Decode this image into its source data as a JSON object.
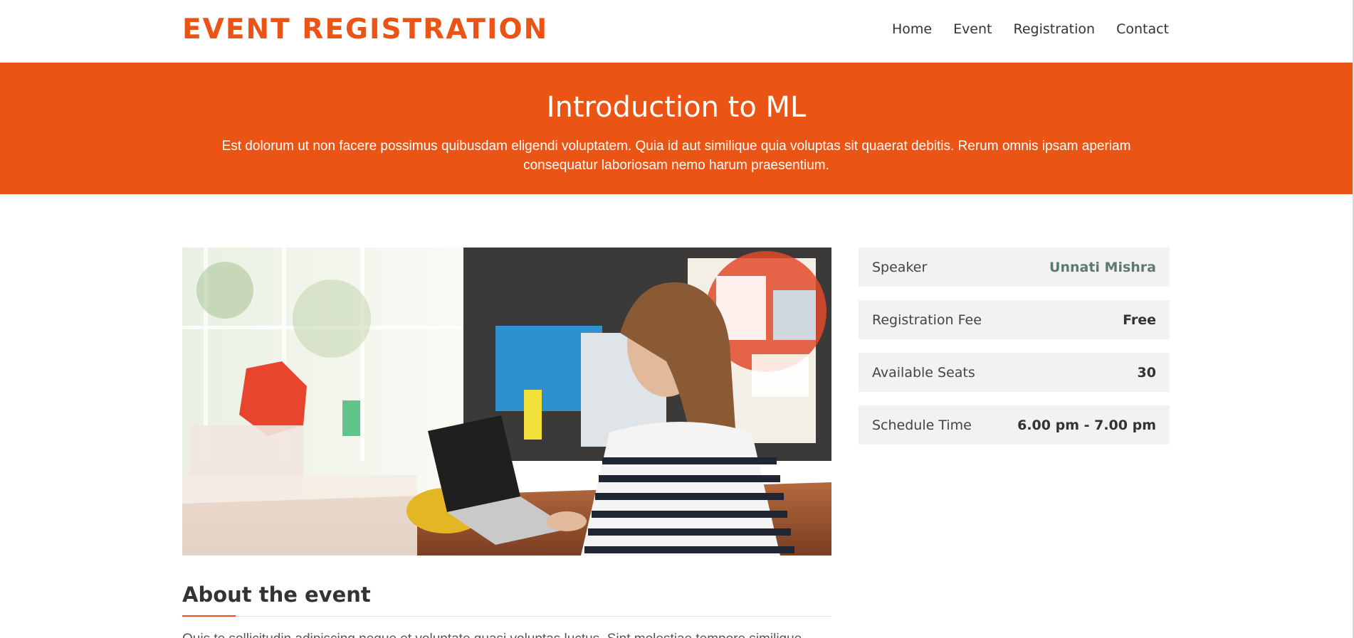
{
  "header": {
    "logo": "EVENT REGISTRATION",
    "nav": [
      "Home",
      "Event",
      "Registration",
      "Contact"
    ]
  },
  "hero": {
    "title": "Introduction to ML",
    "description": "Est dolorum ut non facere possimus quibusdam eligendi voluptatem. Quia id aut similique quia voluptas sit quaerat debitis. Rerum omnis ipsam aperiam consequatur laboriosam nemo harum praesentium."
  },
  "event_info": [
    {
      "label": "Speaker",
      "value": "Unnati Mishra"
    },
    {
      "label": "Registration Fee",
      "value": "Free"
    },
    {
      "label": "Available Seats",
      "value": "30"
    },
    {
      "label": "Schedule Time",
      "value": "6.00 pm - 7.00 pm"
    }
  ],
  "about": {
    "title": "About the event",
    "text": "Quis te sollicitudin adipiscing neque et voluptate quasi voluptas luctus. Sint molestiae tempore similique consequatur."
  },
  "colors": {
    "accent": "#ea5414",
    "info_bg": "#f2f2f2",
    "speaker_value": "#5e7a6e"
  }
}
